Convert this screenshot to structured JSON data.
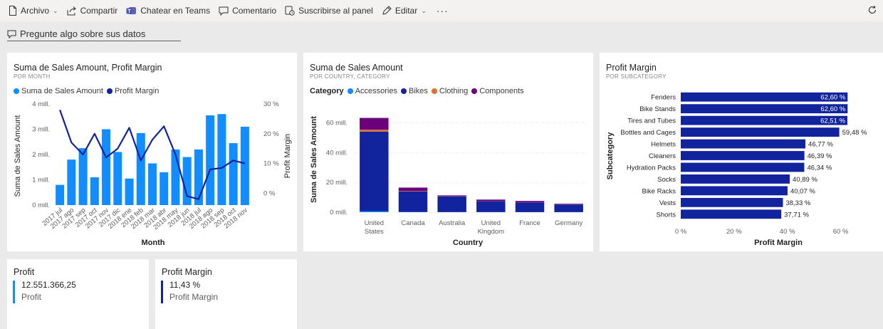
{
  "toolbar": {
    "file": "Archivo",
    "share": "Compartir",
    "teams": "Chatear en Teams",
    "comment": "Comentario",
    "subscribe": "Suscribirse al panel",
    "edit": "Editar",
    "more": "···"
  },
  "qa": {
    "placeholder": "Pregunte algo sobre sus datos"
  },
  "colors": {
    "bar_light": "#118dff",
    "navy": "#12239e",
    "orange": "#e66c37",
    "purple": "#6b007b"
  },
  "tiles": {
    "combo": {
      "title": "Suma de Sales Amount, Profit Margin",
      "subtitle": "POR MONTH"
    },
    "stacked": {
      "title": "Suma de Sales Amount",
      "subtitle": "POR COUNTRY, CATEGORY"
    },
    "hbar": {
      "title": "Profit Margin",
      "subtitle": "POR SUBCATEGORY"
    },
    "card_profit": {
      "title": "Profit",
      "value": "12.551.366,25",
      "label": "Profit"
    },
    "card_margin": {
      "title": "Profit Margin",
      "value": "11,43 %",
      "label": "Profit Margin"
    }
  },
  "chart_data": [
    {
      "type": "bar+line",
      "title": "Suma de Sales Amount, Profit Margin",
      "subtitle": "POR MONTH",
      "xlabel": "Month",
      "ylabel": "Suma de Sales Amount",
      "y2label": "Profit Margin",
      "ylim": [
        0,
        4000000
      ],
      "y2lim": [
        -0.04,
        0.3
      ],
      "yticks": [
        "0 mill.",
        "1 mill.",
        "2 mill.",
        "3 mill.",
        "4 mill."
      ],
      "y2ticks": [
        "0 %",
        "10 %",
        "20 %",
        "30 %"
      ],
      "categories": [
        "2017 jul",
        "2017 ago",
        "2017 sep",
        "2017 oct",
        "2017 nov",
        "2017 dic",
        "2018 ene",
        "2018 feb",
        "2018 mar",
        "2018 abr",
        "2018 may",
        "2018 jun",
        "2018 jul",
        "2018 ago",
        "2018 sep",
        "2018 oct",
        "2018 nov"
      ],
      "series": [
        {
          "name": "Suma de Sales Amount",
          "type": "bar",
          "values": [
            800000,
            1800000,
            2250000,
            1100000,
            3000000,
            2100000,
            1050000,
            2850000,
            1650000,
            1300000,
            2200000,
            1900000,
            2200000,
            3550000,
            3600000,
            2450000,
            3100000
          ]
        },
        {
          "name": "Profit Margin",
          "type": "line",
          "values": [
            0.28,
            0.17,
            0.13,
            0.2,
            0.12,
            0.15,
            0.22,
            0.11,
            0.18,
            0.225,
            0.13,
            -0.01,
            -0.02,
            0.08,
            0.085,
            0.11,
            0.1
          ]
        }
      ],
      "legend": "top-left"
    },
    {
      "type": "bar",
      "stacked": true,
      "title": "Suma de Sales Amount",
      "subtitle": "POR COUNTRY, CATEGORY",
      "xlabel": "Country",
      "ylabel": "Suma de Sales Amount",
      "legend_title": "Category",
      "ylim": [
        0,
        68000000
      ],
      "yticks": [
        "0 mill.",
        "20 mill.",
        "40 mill.",
        "60 mill."
      ],
      "categories": [
        "United States",
        "Canada",
        "Australia",
        "United Kingdom",
        "France",
        "Germany"
      ],
      "series": [
        {
          "name": "Accessories",
          "values": [
            700000,
            150000,
            100000,
            70000,
            60000,
            50000
          ]
        },
        {
          "name": "Bikes",
          "values": [
            53500000,
            13900000,
            10600000,
            7400000,
            6400000,
            5100000
          ]
        },
        {
          "name": "Clothing",
          "values": [
            1300000,
            300000,
            150000,
            120000,
            100000,
            80000
          ]
        },
        {
          "name": "Components",
          "values": [
            7900000,
            2200000,
            500000,
            900000,
            1000000,
            450000
          ]
        }
      ],
      "legend": "top-left"
    },
    {
      "type": "bar",
      "orientation": "horizontal",
      "title": "Profit Margin",
      "subtitle": "POR SUBCATEGORY",
      "xlabel": "Profit Margin",
      "ylabel": "Subcategory",
      "xlim": [
        0,
        0.7
      ],
      "xticks": [
        "0 %",
        "20 %",
        "40 %",
        "60 %"
      ],
      "categories": [
        "Fenders",
        "Bike Stands",
        "Tires and Tubes",
        "Bottles and Cages",
        "Helmets",
        "Cleaners",
        "Hydration Packs",
        "Socks",
        "Bike Racks",
        "Vests",
        "Shorts"
      ],
      "values": [
        0.626,
        0.626,
        0.6251,
        0.5948,
        0.4677,
        0.4639,
        0.4634,
        0.4089,
        0.4007,
        0.3833,
        0.3771
      ],
      "labels": [
        "62,60 %",
        "62,60 %",
        "62,51 %",
        "59,48 %",
        "46,77 %",
        "46,39 %",
        "46,34 %",
        "40,89 %",
        "40,07 %",
        "38,33 %",
        "37,71 %"
      ]
    }
  ]
}
